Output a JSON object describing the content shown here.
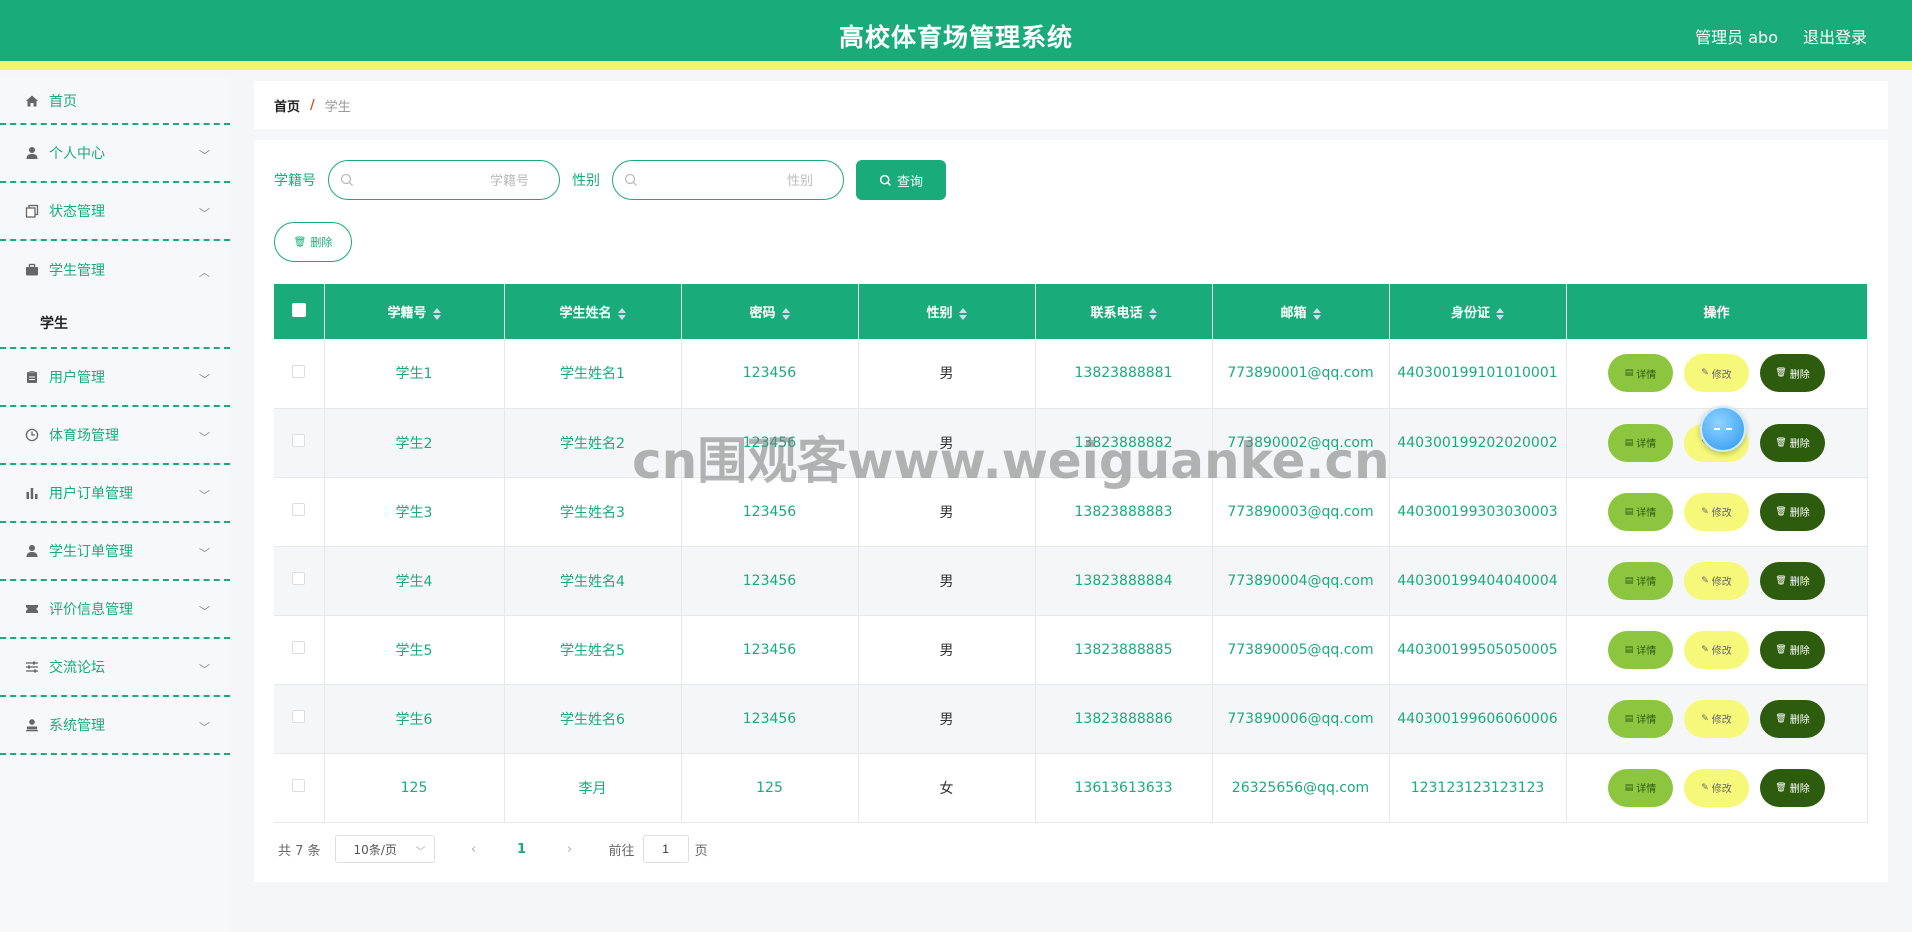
{
  "header": {
    "title": "高校体育场管理系统",
    "user": "管理员 abo",
    "logout": "退出登录"
  },
  "sidebar": {
    "items": [
      {
        "label": "首页",
        "icon": "home-icon"
      },
      {
        "label": "个人中心",
        "icon": "user-icon"
      },
      {
        "label": "状态管理",
        "icon": "copy-icon"
      },
      {
        "label": "学生管理",
        "icon": "briefcase-icon",
        "expanded": true,
        "children": [
          "学生"
        ]
      },
      {
        "label": "用户管理",
        "icon": "clipboard-icon"
      },
      {
        "label": "体育场管理",
        "icon": "clock-icon"
      },
      {
        "label": "用户订单管理",
        "icon": "bar-chart-icon"
      },
      {
        "label": "学生订单管理",
        "icon": "user-icon"
      },
      {
        "label": "评价信息管理",
        "icon": "ticket-icon"
      },
      {
        "label": "交流论坛",
        "icon": "sliders-icon"
      },
      {
        "label": "系统管理",
        "icon": "user-stamp-icon"
      }
    ]
  },
  "breadcrumb": {
    "home": "首页",
    "separator": "/",
    "current": "学生"
  },
  "search": {
    "field1_label": "学籍号",
    "field1_placeholder": "学籍号",
    "field2_label": "性别",
    "field2_placeholder": "性别",
    "query_button": "查询"
  },
  "toolbar": {
    "delete_label": "删除"
  },
  "table": {
    "columns": [
      "学籍号",
      "学生姓名",
      "密码",
      "性别",
      "联系电话",
      "邮箱",
      "身份证",
      "操作"
    ],
    "rows": [
      [
        "学生1",
        "学生姓名1",
        "123456",
        "男",
        "13823888881",
        "773890001@qq.com",
        "440300199101010001"
      ],
      [
        "学生2",
        "学生姓名2",
        "123456",
        "男",
        "13823888882",
        "773890002@qq.com",
        "440300199202020002"
      ],
      [
        "学生3",
        "学生姓名3",
        "123456",
        "男",
        "13823888883",
        "773890003@qq.com",
        "440300199303030003"
      ],
      [
        "学生4",
        "学生姓名4",
        "123456",
        "男",
        "13823888884",
        "773890004@qq.com",
        "440300199404040004"
      ],
      [
        "学生5",
        "学生姓名5",
        "123456",
        "男",
        "13823888885",
        "773890005@qq.com",
        "440300199505050005"
      ],
      [
        "学生6",
        "学生姓名6",
        "123456",
        "男",
        "13823888886",
        "773890006@qq.com",
        "440300199606060006"
      ],
      [
        "125",
        "李月",
        "125",
        "女",
        "13613613633",
        "26325656@qq.com",
        "123123123123123"
      ]
    ],
    "actions": {
      "detail": "详情",
      "edit": "修改",
      "delete": "删除"
    }
  },
  "pagination": {
    "total": "共 7 条",
    "page_size": "10条/页",
    "current_page": "1",
    "goto_label": "前往",
    "goto_value": "1",
    "page_unit": "页"
  },
  "watermark": "cn围观客www.weiguanke.cn",
  "colors": {
    "primary": "#1aab7a",
    "accent_yellow": "#f2f76a",
    "detail": "#8cc63f",
    "edit": "#f6f87a",
    "delete": "#2e5c0e"
  }
}
